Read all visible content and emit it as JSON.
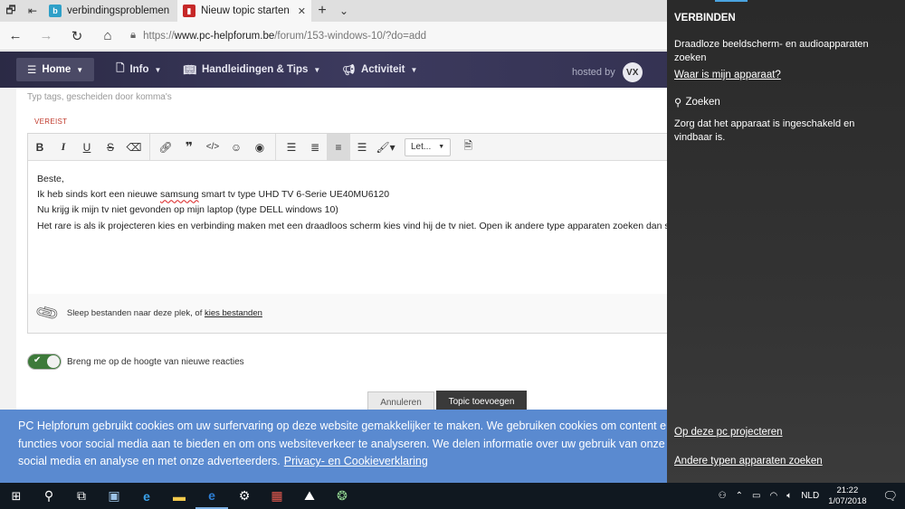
{
  "browser": {
    "tabs": [
      {
        "title": "verbindingsproblemen bij b",
        "active": false,
        "favicon_letter": "b",
        "favicon_color": "#2fa0c8"
      },
      {
        "title": "Nieuw topic starten - PC",
        "active": true,
        "favicon_letter": "",
        "favicon_color": "#c62828"
      }
    ],
    "new_tab": "+",
    "tab_menu": "⌄",
    "url_prefix": "https://",
    "url_host": "www.pc-helpforum.be",
    "url_path": "/forum/153-windows-10/?do=add"
  },
  "site_nav": {
    "home": "Home",
    "items": [
      "Info",
      "Handleidingen & Tips",
      "Activiteit"
    ],
    "hosted_by": "hosted by",
    "hosted_logo": "VX"
  },
  "form": {
    "tags_hint": "Typ tags, gescheiden door komma's",
    "required_label": "VEREIST",
    "font_select": "Let...",
    "body": {
      "line1": "Beste,",
      "line2_pre": "Ik heb sinds kort een nieuwe ",
      "line2_spell": "samsung",
      "line2_post": " smart tv type UHD TV 6-Serie UE40MU6120",
      "line3": "Nu krijg ik mijn tv niet gevonden op mijn laptop (type DELL windows 10)",
      "line4": "Het rare is als ik projecteren kies en verbinding maken met een draadloos scherm kies vind hij de tv niet. Open ik andere type apparaten zoeken dan staat hij er"
    },
    "attach_text": "Sleep bestanden naar deze plek, of",
    "attach_link": "kies bestanden",
    "follow_label": "Breng me op de hoogte van nieuwe reacties",
    "cancel_button": "Annuleren",
    "submit_button": "Topic toevoegen"
  },
  "cookie": {
    "line1": "PC Helpforum gebruikt cookies om uw surfervaring op deze website gemakkelijker te maken. We gebruiken cookies om content en advertenties",
    "line2": "functies voor social media aan te bieden en om ons websiteverkeer te analyseren. We delen informatie over uw gebruik van onze site met onze partners",
    "line3": "social media en analyse en met onze adverteerders.",
    "link": "Privacy- en Cookieverklaring"
  },
  "connect_panel": {
    "title": "VERBINDEN",
    "description": "Draadloze beeldscherm- en audioapparaten zoeken",
    "where_link": "Waar is mijn apparaat?",
    "searching": "Zoeken",
    "hint": "Zorg dat het apparaat is ingeschakeld en vindbaar is.",
    "project_link": "Op deze pc projecteren",
    "other_link": "Andere typen apparaten zoeken"
  },
  "taskbar": {
    "lang": "NLD",
    "time": "21:22",
    "date": "1/07/2018"
  }
}
